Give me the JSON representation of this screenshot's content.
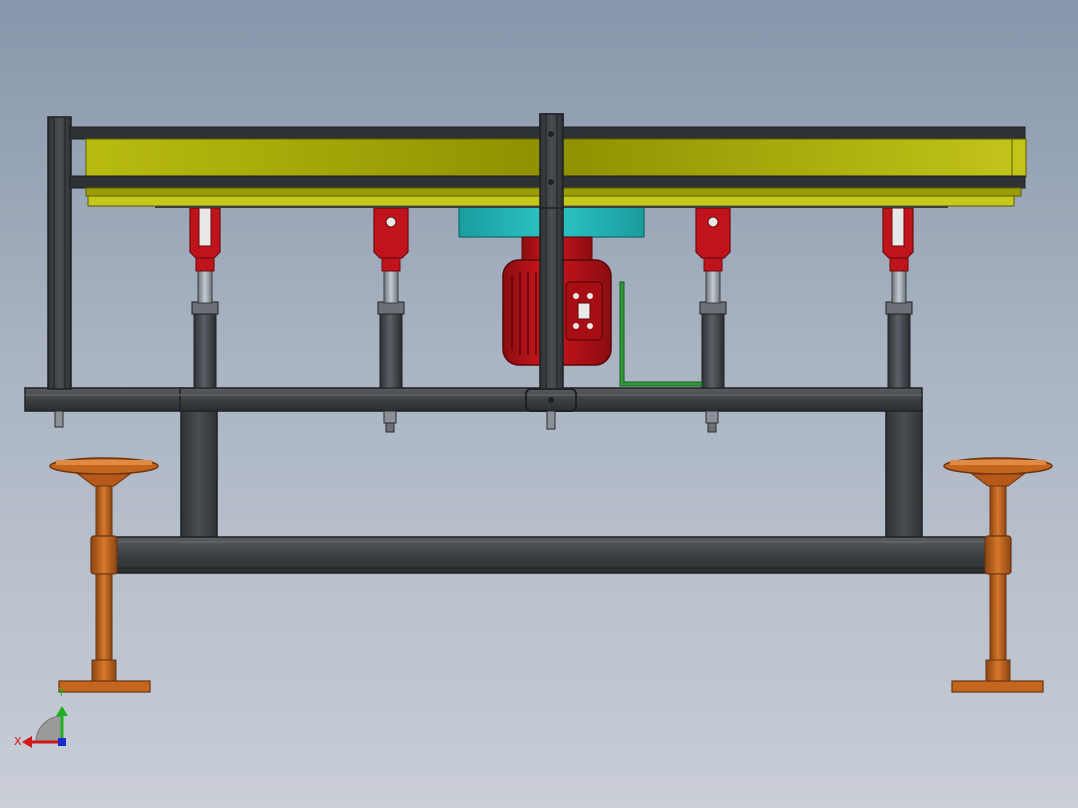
{
  "viewport": {
    "background_top": "#8797ab",
    "background_bottom": "#c9ced7"
  },
  "colors": {
    "frame": "#3b3e42",
    "frame_light": "#55585d",
    "frame_edge": "#1e2022",
    "rail": "#a5a800",
    "rail_light": "#c6c81c",
    "clevis": "#c0141c",
    "clevis_dark": "#7d0d12",
    "motor": "#c8141c",
    "motor_dark": "#8a0c10",
    "coupling": "#1fb0b0",
    "bracket": "#2f9a3a",
    "stand": "#c5661e",
    "stand_dark": "#8b4512",
    "rod": "#9aa0a8",
    "axis_x": "#d01818",
    "axis_y": "#20b020",
    "axis_z": "#1a2ad0"
  },
  "triad": {
    "x_label": "X",
    "y_label": "Y"
  }
}
